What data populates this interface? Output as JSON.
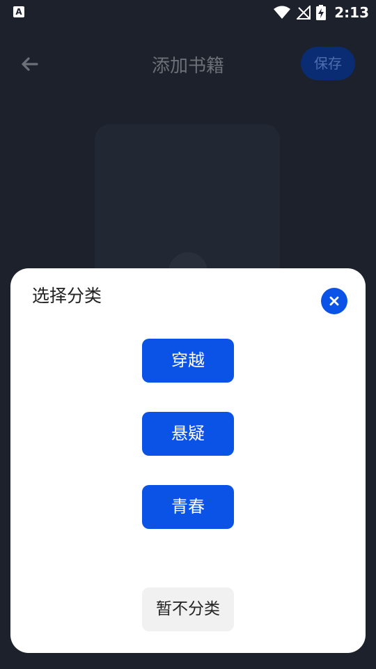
{
  "status_bar": {
    "left_icon_letter": "A",
    "time": "2:13",
    "icons": [
      "wifi-icon",
      "no-signal-icon",
      "battery-charging-icon"
    ]
  },
  "app_bar": {
    "back_icon": "arrow-left-icon",
    "title": "添加书籍",
    "save_label": "保存"
  },
  "dialog": {
    "title": "选择分类",
    "close_icon": "close-icon",
    "categories": [
      {
        "label": "穿越"
      },
      {
        "label": "悬疑"
      },
      {
        "label": "青春"
      }
    ],
    "skip_label": "暂不分类"
  },
  "colors": {
    "accent": "#0b53e6",
    "background": "#1c212c",
    "dialog_background": "#ffffff",
    "skip_button_background": "#f1f1f1"
  }
}
